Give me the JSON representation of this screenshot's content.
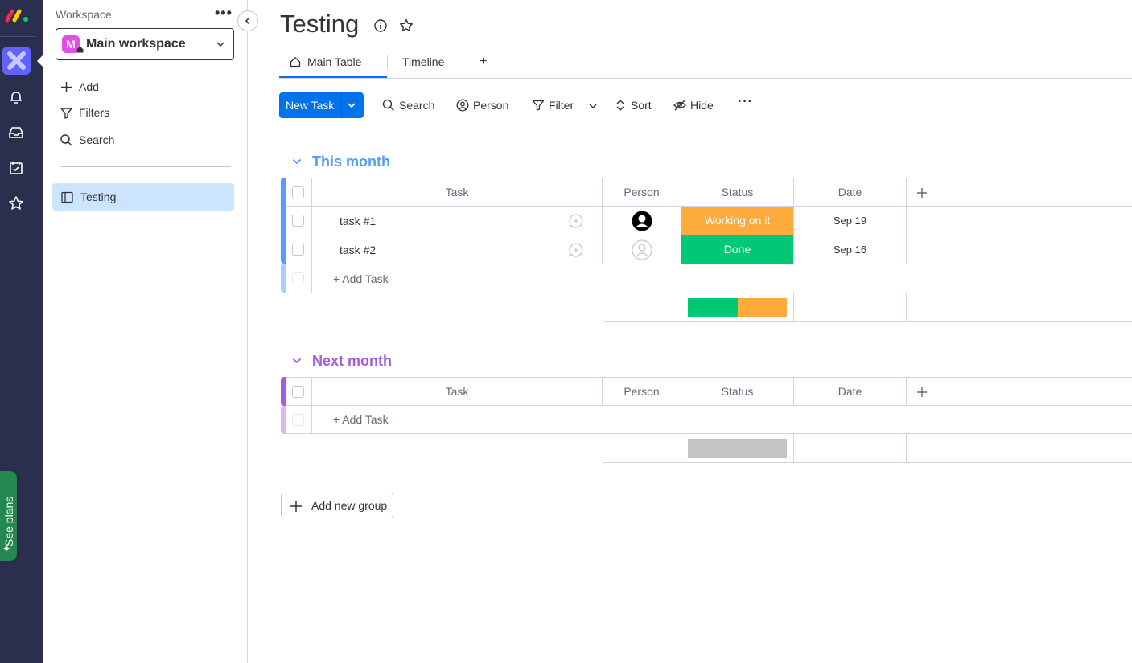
{
  "sidebar": {
    "workspace_label": "Workspace",
    "workspace_name": "Main workspace",
    "workspace_initial": "M",
    "items": [
      {
        "label": "Add",
        "icon": "plus-icon"
      },
      {
        "label": "Filters",
        "icon": "filter-icon"
      },
      {
        "label": "Search",
        "icon": "search-icon"
      }
    ],
    "boards": [
      {
        "label": "Testing",
        "icon": "board-icon"
      }
    ],
    "see_plans": "See plans"
  },
  "board": {
    "title": "Testing",
    "tabs": [
      {
        "label": "Main Table",
        "icon": "home-icon",
        "active": true
      },
      {
        "label": "Timeline",
        "active": false
      }
    ],
    "add_tab": "+"
  },
  "toolbar": {
    "new_task": "New Task",
    "search": "Search",
    "person": "Person",
    "filter": "Filter",
    "sort": "Sort",
    "hide": "Hide"
  },
  "columns": [
    "Task",
    "Person",
    "Status",
    "Date"
  ],
  "groups": [
    {
      "title": "This month",
      "color": "#579bfc",
      "rows": [
        {
          "task": "task #1",
          "person": "filled",
          "status": "Working on it",
          "status_color": "#fdab3d",
          "date": "Sep 19"
        },
        {
          "task": "task #2",
          "person": "empty",
          "status": "Done",
          "status_color": "#00c875",
          "date": "Sep 16"
        }
      ],
      "add_task": "+ Add Task",
      "summary": [
        {
          "color": "#00c875",
          "fraction": 0.5
        },
        {
          "color": "#fdab3d",
          "fraction": 0.5
        }
      ]
    },
    {
      "title": "Next month",
      "color": "#a25ddc",
      "rows": [],
      "add_task": "+ Add Task",
      "summary": [
        {
          "color": "#c4c4c4",
          "fraction": 1.0
        }
      ]
    }
  ],
  "add_group": "Add new group"
}
